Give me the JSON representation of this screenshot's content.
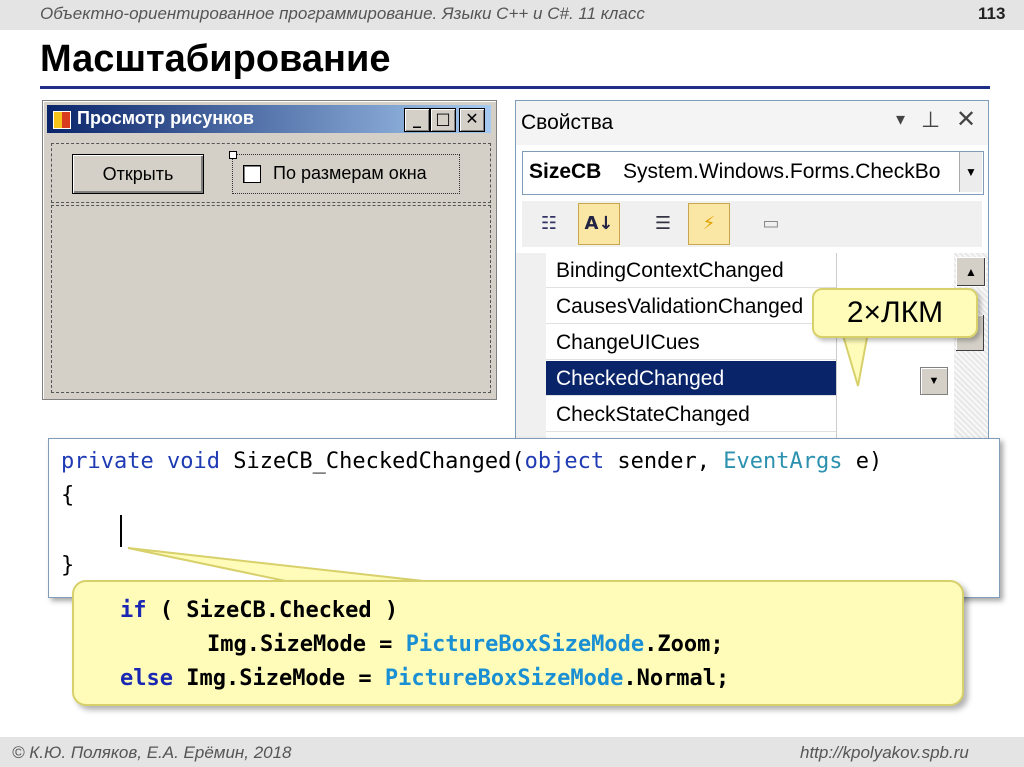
{
  "slide": {
    "course": "Объектно-ориентированное программирование. Языки C++ и C#. 11 класс",
    "page_number": "113",
    "title": "Масштабирование",
    "author": "© К.Ю. Поляков, Е.А. Ерёмин, 2018",
    "site": "http://kpolyakov.spb.ru"
  },
  "form": {
    "title": "Просмотр рисунков",
    "min": "_",
    "max": "□",
    "close": "✕",
    "open_button": "Открыть",
    "checkbox_label": "По размерам окна"
  },
  "properties": {
    "title": "Свойства",
    "object_name": "SizeCB",
    "object_type": "System.Windows.Forms.CheckBo",
    "events": [
      "BindingContextChanged",
      "CausesValidationChanged",
      "ChangeUICues",
      "CheckedChanged",
      "CheckStateChanged"
    ],
    "selected_event": "CheckedChanged"
  },
  "callout": {
    "text": "2×ЛКМ"
  },
  "code": {
    "l1_kw": "private void",
    "l1_name": " SizeCB_CheckedChanged(",
    "l1_obj": "object",
    "l1_sender": " sender, ",
    "l1_type": "EventArgs",
    "l1_end": " e)",
    "l2": "{",
    "l4": "}"
  },
  "tip": {
    "if_kw": "if",
    "if_rest": "( SizeCB.Checked )",
    "zoom_lhs": "Img.SizeMode = ",
    "zoom_cls": "PictureBoxSizeMode",
    "zoom_rest": ".Zoom;",
    "else_kw": "else",
    "normal_lhs": " Img.SizeMode = ",
    "normal_cls": "PictureBoxSizeMode",
    "normal_rest": ".Normal;"
  }
}
